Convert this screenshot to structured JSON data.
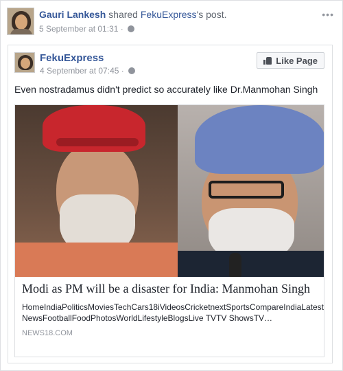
{
  "outer_post": {
    "author": "Gauri Lankesh",
    "action": "shared",
    "source": "FekuExpress",
    "source_suffix": "'s post.",
    "timestamp": "5 September at 01:31 ·"
  },
  "inner_post": {
    "page_name": "FekuExpress",
    "timestamp": "4 September at 07:45 ·",
    "like_button": "Like Page",
    "text": "Even nostradamus didn't predict so accurately like Dr.Manmohan Singh",
    "link": {
      "title": "Modi as PM will be a disaster for India: Manmohan Singh",
      "description": "HomeIndiaPoliticsMoviesTechCars18iVideosCricketnextSportsCompareIndiaLatest NewsFootballFoodPhotosWorldLifestyleBlogsLive TVTV ShowsTV…",
      "domain": "NEWS18.COM"
    }
  },
  "icons": [
    "globe-icon",
    "more-options-icon",
    "thumbs-up-icon"
  ]
}
